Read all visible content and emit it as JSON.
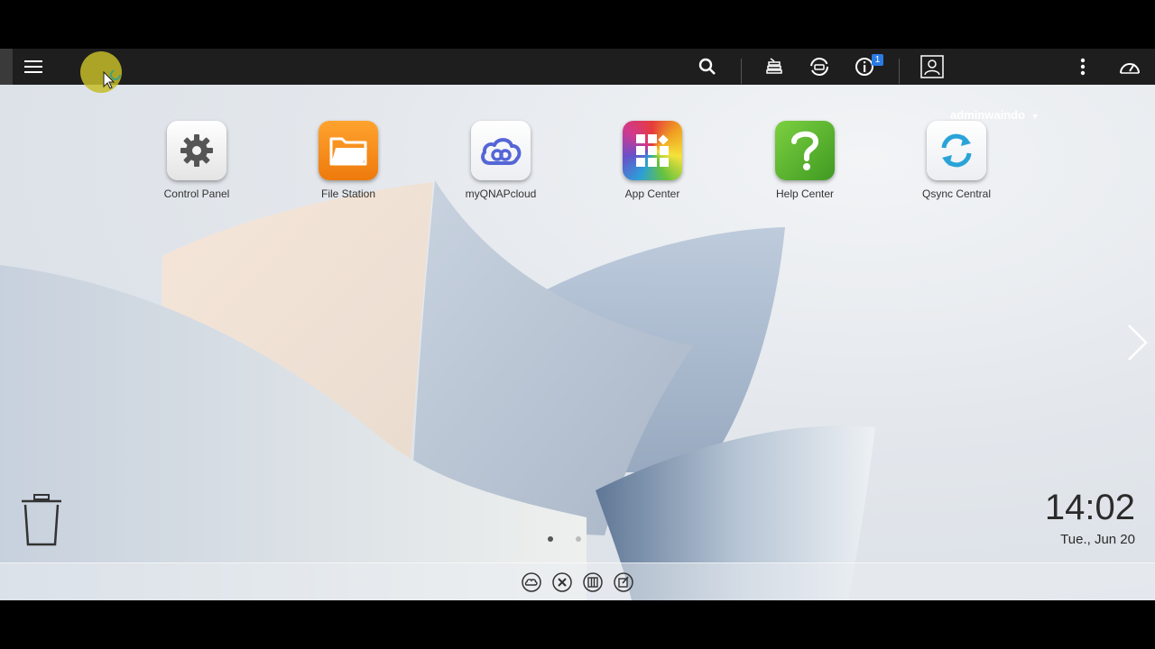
{
  "topbar": {
    "menu_icon": "hamburger-icon",
    "search_icon": "search-icon",
    "tasks_icon": "background-tasks-icon",
    "sync_icon": "sync-icon",
    "notification_icon": "info-icon",
    "notification_count": "1",
    "user_icon": "user-icon",
    "username": "adminwaindo",
    "more_icon": "more-vertical-icon",
    "dashboard_icon": "dashboard-gauge-icon"
  },
  "apps": [
    {
      "label": "Control Panel",
      "icon": "gear-icon"
    },
    {
      "label": "File Station",
      "icon": "folder-icon"
    },
    {
      "label": "myQNAPcloud",
      "icon": "cloud-icon"
    },
    {
      "label": "App Center",
      "icon": "app-grid-icon"
    },
    {
      "label": "Help Center",
      "icon": "question-icon"
    },
    {
      "label": "Qsync Central",
      "icon": "sync-arrows-icon"
    }
  ],
  "clock": {
    "time": "14:02",
    "date": "Tue., Jun 20"
  },
  "pagination": {
    "pages": 2,
    "current": 1
  },
  "dock": [
    {
      "icon": "cloud-link-icon"
    },
    {
      "icon": "tools-icon"
    },
    {
      "icon": "panel-icon"
    },
    {
      "icon": "notes-icon"
    }
  ],
  "colors": {
    "topbar": "#1e1e1e",
    "accent_badge": "#2a7be4",
    "file_station": "#f28c1a",
    "help_center": "#5fb32e",
    "qsync": "#2aa3d8"
  }
}
